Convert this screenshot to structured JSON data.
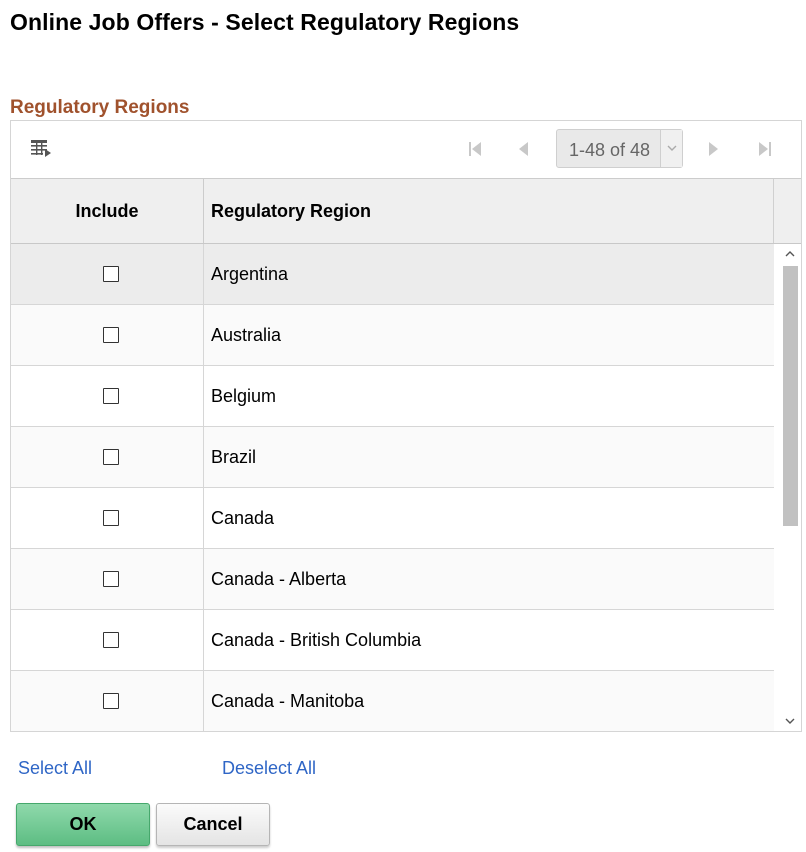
{
  "page": {
    "title": "Online Job Offers - Select Regulatory Regions"
  },
  "section": {
    "title": "Regulatory Regions"
  },
  "toolbar": {
    "view_icon": "grid-view-icon",
    "pager_text": "1-48 of 48",
    "nav_icons": [
      "first-page-icon",
      "previous-page-icon",
      "next-page-icon",
      "last-page-icon"
    ]
  },
  "grid": {
    "columns": [
      "Include",
      "Regulatory Region"
    ],
    "rows": [
      {
        "region": "Argentina",
        "included": false
      },
      {
        "region": "Australia",
        "included": false
      },
      {
        "region": "Belgium",
        "included": false
      },
      {
        "region": "Brazil",
        "included": false
      },
      {
        "region": "Canada",
        "included": false
      },
      {
        "region": "Canada - Alberta",
        "included": false
      },
      {
        "region": "Canada - British Columbia",
        "included": false
      },
      {
        "region": "Canada - Manitoba",
        "included": false
      }
    ]
  },
  "links": {
    "select_all": "Select All",
    "deselect_all": "Deselect All"
  },
  "buttons": {
    "ok": "OK",
    "cancel": "Cancel"
  },
  "colors": {
    "section_title": "#a0522d",
    "link": "#2f66c6",
    "ok_button": "#5dbd83",
    "header_bg": "#efefef"
  }
}
